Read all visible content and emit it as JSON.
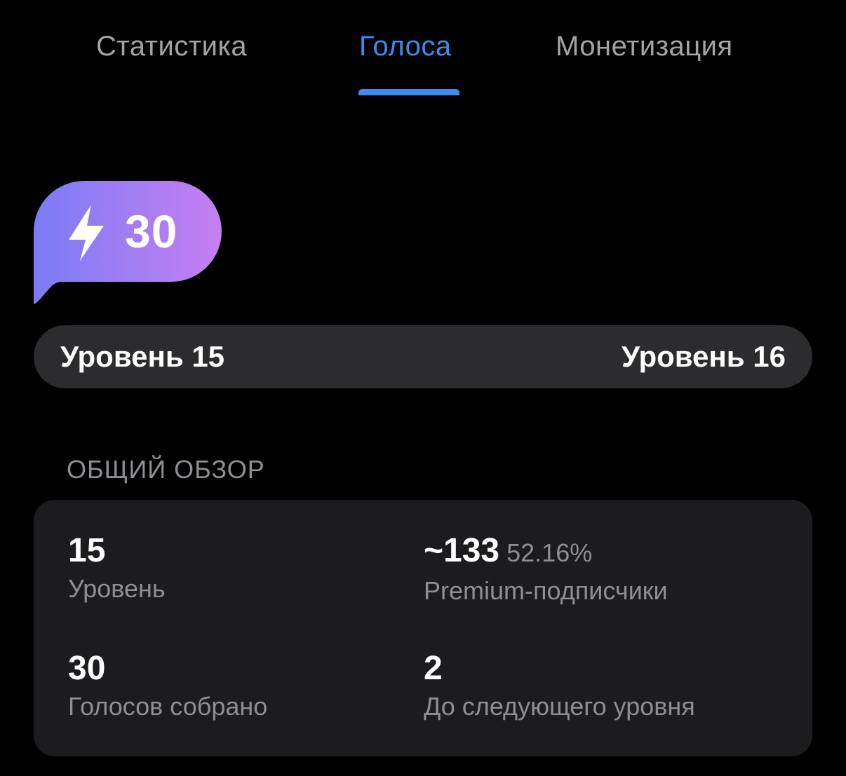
{
  "tabs": [
    {
      "label": "Статистика",
      "active": false
    },
    {
      "label": "Голоса",
      "active": true
    },
    {
      "label": "Монетизация",
      "active": false
    }
  ],
  "colors": {
    "accent": "#3e8af0",
    "background": "#000000",
    "level_bar": "#2c2c2e",
    "card": "#1c1c1e",
    "muted_text": "#8e8e93",
    "badge_gradient_start": "#7b7cf6",
    "badge_gradient_end": "#c57ff0"
  },
  "badge": {
    "icon": "lightning-bolt-icon",
    "count": "30"
  },
  "level": {
    "current": "Уровень 15",
    "next": "Уровень 16"
  },
  "overview": {
    "title": "ОБЩИЙ ОБЗОР",
    "level_value": "15",
    "level_label": "Уровень",
    "premium_value": "~133",
    "premium_percent": "52.16%",
    "premium_label": "Premium-подписчики",
    "votes_value": "30",
    "votes_label": "Голосов собрано",
    "next_value": "2",
    "next_label": "До следующего уровня"
  }
}
